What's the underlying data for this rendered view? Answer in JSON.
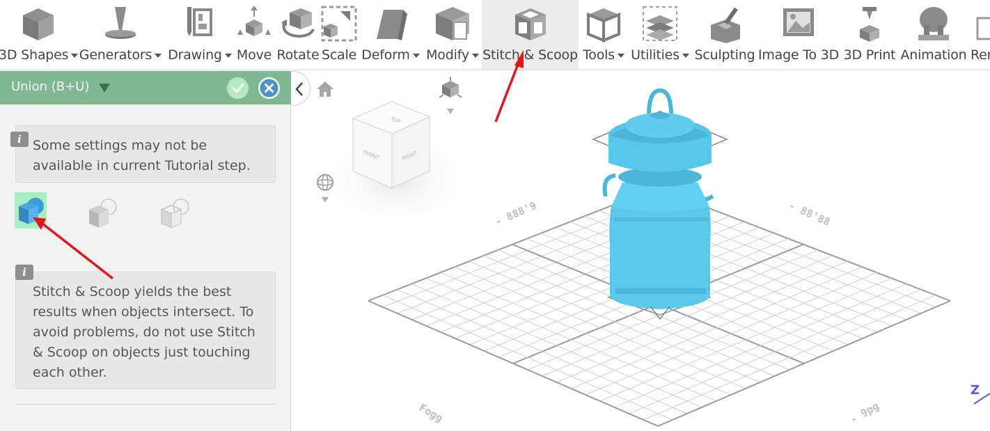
{
  "toolbar": {
    "items": [
      {
        "label": "3D Shapes",
        "dropdown": true,
        "icon": "cube-icon"
      },
      {
        "label": "Generators",
        "dropdown": true,
        "icon": "generator-pin-icon"
      },
      {
        "label": "Drawing",
        "dropdown": true,
        "icon": "drawing-pencil-icon"
      },
      {
        "label": "Move",
        "dropdown": false,
        "icon": "move-arrows-icon"
      },
      {
        "label": "Rotate",
        "dropdown": false,
        "icon": "rotate-icon"
      },
      {
        "label": "Scale",
        "dropdown": false,
        "icon": "scale-icon"
      },
      {
        "label": "Deform",
        "dropdown": true,
        "icon": "deform-icon"
      },
      {
        "label": "Modify",
        "dropdown": true,
        "icon": "modify-icon"
      },
      {
        "label": "Stitch & Scoop",
        "dropdown": false,
        "icon": "stitch-scoop-icon",
        "active": true
      },
      {
        "label": "Tools",
        "dropdown": true,
        "icon": "tools-icon"
      },
      {
        "label": "Utilities",
        "dropdown": true,
        "icon": "utilities-icon"
      },
      {
        "label": "Sculpting",
        "dropdown": false,
        "icon": "sculpting-icon"
      },
      {
        "label": "Image To 3D",
        "dropdown": false,
        "icon": "image-to-3d-icon"
      },
      {
        "label": "3D Print",
        "dropdown": false,
        "icon": "3d-print-icon"
      },
      {
        "label": "Animation",
        "dropdown": false,
        "icon": "animation-icon"
      },
      {
        "label": "Ren",
        "dropdown": false,
        "icon": "render-icon"
      }
    ]
  },
  "panel": {
    "operation": "Union (B+U)",
    "info1": "Some settings may not be available in current Tutorial step.",
    "info2": "Stitch & Scoop yields the best results when objects intersect. To avoid problems, do not use Stitch & Scoop on objects just touching each other.",
    "modes": [
      {
        "name": "union",
        "icon": "union-icon",
        "selected": true
      },
      {
        "name": "subtract",
        "icon": "subtract-icon",
        "selected": false
      },
      {
        "name": "intersect",
        "icon": "intersect-icon",
        "selected": false
      }
    ]
  },
  "viewport": {
    "view_cube": {
      "top": "TOP",
      "front": "FRONT",
      "right": "RIGHT"
    },
    "grid_labels": [
      "- 888'9",
      "- 88'88",
      "Fogg",
      "- 9pg"
    ],
    "axis_label": "Z",
    "object_color": "#56c8e8"
  },
  "colors": {
    "accent_green": "#7fb893",
    "selected_mode": "#a8f0c0",
    "arrow": "#e8141a"
  }
}
